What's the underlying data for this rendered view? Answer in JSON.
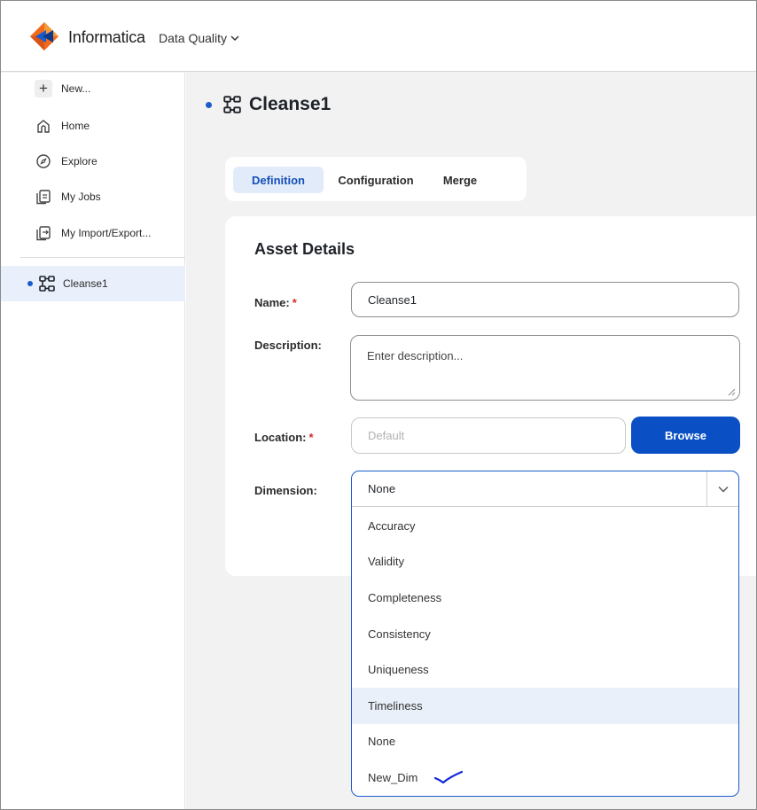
{
  "header": {
    "brand": "Informatica",
    "product": "Data Quality",
    "brand_color": "#f26b1d",
    "accent_color": "#0a4fc4"
  },
  "sidebar": {
    "items": [
      {
        "label": "New...",
        "icon": "plus-icon"
      },
      {
        "label": "Home",
        "icon": "home-icon"
      },
      {
        "label": "Explore",
        "icon": "compass-icon"
      },
      {
        "label": "My Jobs",
        "icon": "jobs-icon"
      },
      {
        "label": "My Import/Export...",
        "icon": "import-export-icon"
      }
    ],
    "open_asset": {
      "label": "Cleanse1",
      "icon": "mapplet-icon"
    }
  },
  "main": {
    "title": "Cleanse1",
    "tabs": [
      {
        "label": "Definition",
        "active": true
      },
      {
        "label": "Configuration",
        "active": false
      },
      {
        "label": "Merge",
        "active": false
      }
    ],
    "card": {
      "title": "Asset Details",
      "name_label": "Name:",
      "name_value": "Cleanse1",
      "description_label": "Description:",
      "description_placeholder": "Enter description...",
      "location_label": "Location:",
      "location_placeholder": "Default",
      "browse_label": "Browse",
      "dimension_label": "Dimension:",
      "required_mark": "*"
    },
    "dimension_dropdown": {
      "selected": "None",
      "options": [
        "Accuracy",
        "Validity",
        "Completeness",
        "Consistency",
        "Uniqueness",
        "Timeliness",
        "None",
        "New_Dim"
      ],
      "highlighted": "Timeliness",
      "annotated": "New_Dim"
    }
  }
}
